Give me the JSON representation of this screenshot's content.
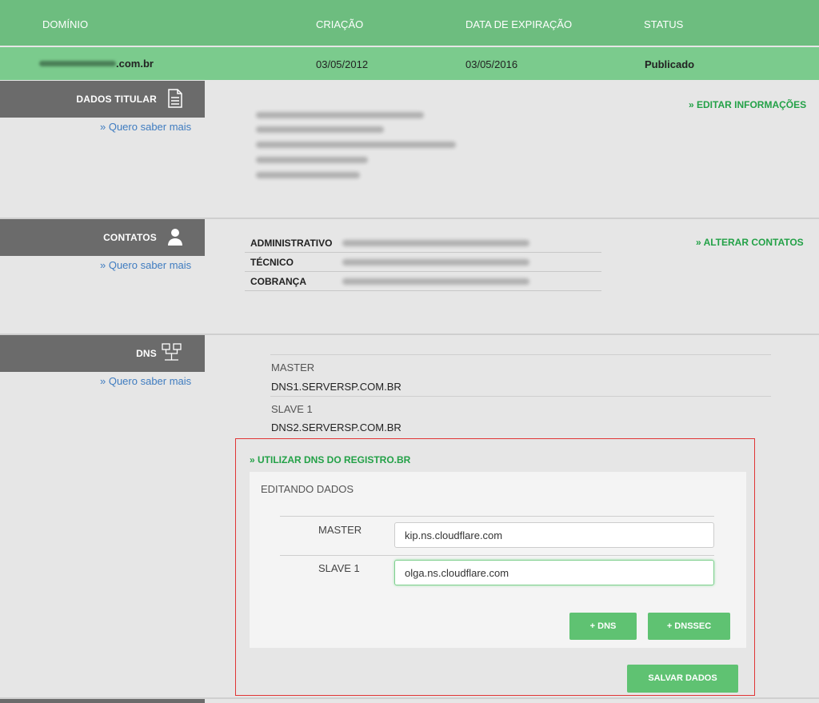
{
  "header": {
    "col_domain": "DOMÍNIO",
    "col_created": "CRIAÇÃO",
    "col_expiration": "DATA DE EXPIRAÇÃO",
    "col_status": "STATUS"
  },
  "domain_row": {
    "domain_suffix": ".com.br",
    "created": "03/05/2012",
    "expiration": "03/05/2016",
    "status": "Publicado"
  },
  "sections": {
    "titular": {
      "title": "DADOS TITULAR",
      "icon": "document-icon",
      "more_link": "» Quero saber mais",
      "action": "» EDITAR INFORMAÇÕES"
    },
    "contatos": {
      "title": "CONTATOS",
      "icon": "user-icon",
      "more_link": "» Quero saber mais",
      "action": "» ALTERAR CONTATOS",
      "rows": [
        "ADMINISTRATIVO",
        "TÉCNICO",
        "COBRANÇA"
      ]
    },
    "dns": {
      "title": "DNS",
      "icon": "network-icon",
      "more_link": "» Quero saber mais",
      "entries": [
        {
          "label": "MASTER",
          "value": "DNS1.SERVERSP.COM.BR"
        },
        {
          "label": "SLAVE 1",
          "value": "DNS2.SERVERSP.COM.BR"
        }
      ],
      "use_registro_link": "» UTILIZAR DNS DO REGISTRO.BR",
      "editing_title": "EDITANDO DADOS",
      "fields": [
        {
          "label": "MASTER",
          "value": "kip.ns.cloudflare.com"
        },
        {
          "label": "SLAVE 1",
          "value": "olga.ns.cloudflare.com"
        }
      ],
      "add_dns_button": "+ DNS",
      "add_dnssec_button": "+ DNSSEC",
      "save_button": "SALVAR DADOS"
    }
  },
  "colors": {
    "header_green": "#6dbd7f",
    "row_green": "#7bcb8d",
    "tab_gray": "#6b6b6b",
    "action_green": "#23a147",
    "link_blue": "#3f7cc0",
    "highlight_red": "#e03535",
    "button_green": "#5fc272"
  }
}
